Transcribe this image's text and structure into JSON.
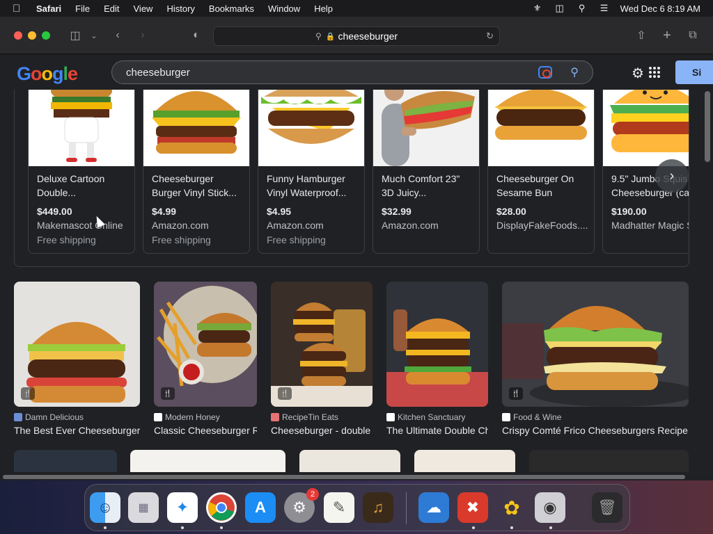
{
  "menubar": {
    "app": "Safari",
    "items": [
      "File",
      "Edit",
      "View",
      "History",
      "Bookmarks",
      "Window",
      "Help"
    ],
    "datetime": "Wed Dec 6  8:19 AM"
  },
  "toolbar": {
    "url": "cheeseburger"
  },
  "google": {
    "logo": [
      "G",
      "o",
      "o",
      "g",
      "l",
      "e"
    ],
    "query": "cheeseburger",
    "signin_label": "Si"
  },
  "products": [
    {
      "title": "Deluxe Cartoon Double...",
      "price": "$449.00",
      "store": "Makemascot Online",
      "shipping": "Free shipping"
    },
    {
      "title": "Cheeseburger Burger Vinyl Stick...",
      "price": "$4.99",
      "store": "Amazon.com",
      "shipping": "Free shipping"
    },
    {
      "title": "Funny Hamburger Vinyl Waterproof...",
      "price": "$4.95",
      "store": "Amazon.com",
      "shipping": "Free shipping"
    },
    {
      "title": "Much Comfort 23\" 3D Juicy...",
      "price": "$32.99",
      "store": "Amazon.com",
      "shipping": ""
    },
    {
      "title": "Cheeseburger On Sesame Bun",
      "price": "$28.00",
      "store": "DisplayFakeFoods....",
      "shipping": ""
    },
    {
      "title": "9.5\" Jumbo Squis Cheeseburger (ca",
      "price": "$190.00",
      "store": "Madhatter Magic S",
      "shipping": ""
    }
  ],
  "images": [
    {
      "source": "Damn Delicious",
      "title": "The Best Ever Cheeseburgers",
      "fav_color": "#6b8fd6"
    },
    {
      "source": "Modern Honey",
      "title": "Classic Cheeseburger Recipe",
      "fav_color": "#ffffff"
    },
    {
      "source": "RecipeTin Eats",
      "title": "Cheeseburger - double",
      "fav_color": "#e57373"
    },
    {
      "source": "Kitchen Sanctuary",
      "title": "The Ultimate Double Cheeseburger",
      "fav_color": "#ffffff"
    },
    {
      "source": "Food & Wine",
      "title": "Crispy Comté Frico Cheeseburgers Recipe",
      "fav_color": "#ffffff"
    }
  ],
  "dock": {
    "settings_badge": "2",
    "apps": [
      "finder-icon",
      "launchpad-icon",
      "safari-icon",
      "chrome-icon",
      "app-store-icon",
      "system-settings-icon",
      "textedit-icon",
      "garageband-icon",
      "weather-icon",
      "remote-desktop-icon",
      "bee-app-icon",
      "game-controller-icon",
      "trash-icon"
    ]
  }
}
